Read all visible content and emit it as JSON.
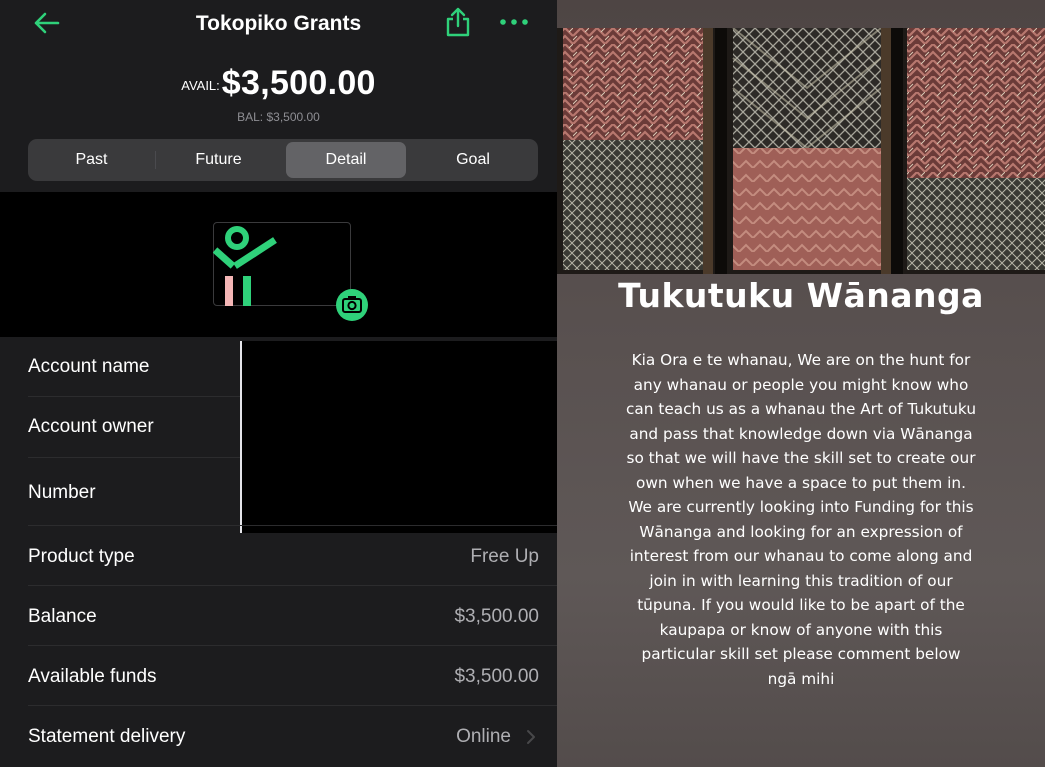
{
  "app": {
    "title": "Tokopiko Grants",
    "avail_label": "AVAIL:",
    "avail_amount": "$3,500.00",
    "balance_line": "BAL: $3,500.00",
    "tabs": [
      {
        "label": "Past",
        "active": false
      },
      {
        "label": "Future",
        "active": false
      },
      {
        "label": "Detail",
        "active": true
      },
      {
        "label": "Goal",
        "active": false
      }
    ],
    "icons": {
      "back": "arrow-left-icon",
      "share": "share-icon",
      "more": "more-dots-icon",
      "camera": "camera-icon",
      "chevron": "chevron-right-icon"
    },
    "details": [
      {
        "label": "Account name",
        "value": ""
      },
      {
        "label": "Account owner",
        "value": ""
      },
      {
        "label": "Number",
        "value": ""
      },
      {
        "label": "Product type",
        "value": "Free Up"
      },
      {
        "label": "Balance",
        "value": "$3,500.00"
      },
      {
        "label": "Available funds",
        "value": "$3,500.00"
      },
      {
        "label": "Statement delivery",
        "value": "Online"
      }
    ],
    "colors": {
      "accent": "#2fd17a",
      "background": "#1c1c1e",
      "logo_pink": "#f4b6b6"
    }
  },
  "poster": {
    "title": "Tukutuku Wānanga",
    "lines": [
      "Kia Ora e te whanau, We are on the hunt for",
      "any whanau or people you might know who",
      "can teach us as a whanau the Art of Tukutuku",
      "and pass that knowledge down via Wānanga",
      "so that we will have the skill set to create our",
      "own when we have a space to put them in.",
      "We are currently looking into Funding for this",
      "Wānanga and looking for an expression of",
      "interest from our whanau to come along and",
      "join in with learning this tradition of our",
      "tūpuna. If you would like to be apart of the",
      "kaupapa or know of anyone with this",
      "particular skill set please comment below",
      "ngā mihi"
    ]
  }
}
